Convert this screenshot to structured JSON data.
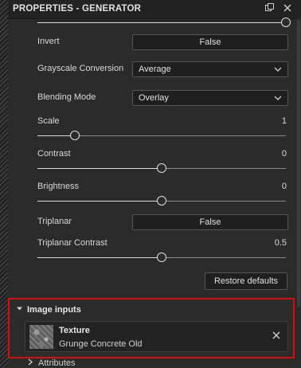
{
  "panel_title": "PROPERTIES - GENERATOR",
  "icons": {
    "float": "float-window-icon",
    "close": "close-icon",
    "chevron": "chevron-down-icon"
  },
  "properties": {
    "invert": {
      "label": "Invert",
      "value": "False"
    },
    "grayscale": {
      "label": "Grayscale Conversion",
      "value": "Average"
    },
    "blending": {
      "label": "Blending Mode",
      "value": "Overlay"
    },
    "scale": {
      "label": "Scale",
      "value": "1",
      "level": 0.15
    },
    "contrast": {
      "label": "Contrast",
      "value": "0",
      "level": 0.5
    },
    "brightness": {
      "label": "Brightness",
      "value": "0",
      "level": 0.5
    },
    "triplanar": {
      "label": "Triplanar",
      "value": "False"
    },
    "triplanar_contrast": {
      "label": "Triplanar Contrast",
      "value": "0.5",
      "level": 0.5
    }
  },
  "restore_label": "Restore defaults",
  "image_inputs": {
    "header": "Image inputs",
    "item": {
      "title": "Texture",
      "name": "Grunge Concrete Old"
    }
  },
  "attributes_label": "Attributes",
  "accent": "#d01010"
}
